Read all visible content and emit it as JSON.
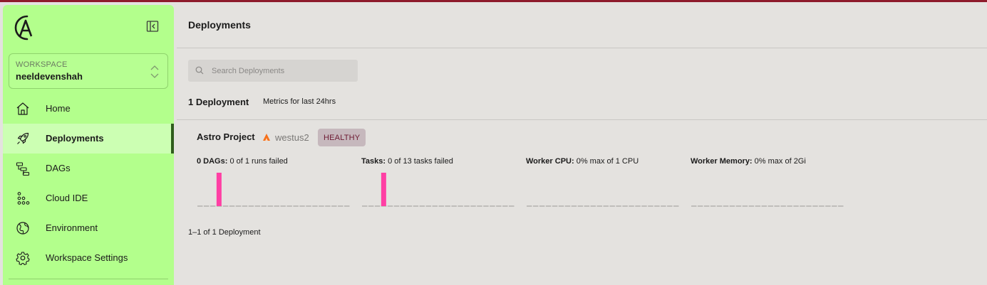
{
  "sidebar": {
    "workspace": {
      "label": "WORKSPACE",
      "name": "neeldevenshah"
    },
    "items": [
      {
        "label": "Home",
        "icon": "home-icon"
      },
      {
        "label": "Deployments",
        "icon": "rocket-icon",
        "active": true
      },
      {
        "label": "DAGs",
        "icon": "dag-icon"
      },
      {
        "label": "Cloud IDE",
        "icon": "cloud-ide-icon"
      },
      {
        "label": "Environment",
        "icon": "globe-icon"
      },
      {
        "label": "Workspace Settings",
        "icon": "gear-icon"
      }
    ]
  },
  "main": {
    "title": "Deployments",
    "search": {
      "placeholder": "Search Deployments",
      "value": ""
    },
    "count": "1 Deployment",
    "metrics_note": "Metrics for last 24hrs",
    "deployment": {
      "name": "Astro Project",
      "region": "westus2",
      "status": "HEALTHY",
      "metrics": [
        {
          "label": "0 DAGs:",
          "detail": "0 of 1 runs failed"
        },
        {
          "label": "Tasks:",
          "detail": "0 of 13 tasks failed"
        },
        {
          "label": "Worker CPU:",
          "detail": "0% max of 1 CPU"
        },
        {
          "label": "Worker Memory:",
          "detail": "0% max of 2Gi"
        }
      ]
    },
    "pagination": "1–1 of 1 Deployment"
  },
  "chart_data": [
    {
      "type": "bar",
      "series": [
        {
          "values": [
            0,
            0,
            0,
            1,
            0,
            0,
            0,
            0,
            0,
            0,
            0,
            0,
            0,
            0,
            0,
            0,
            0,
            0,
            0,
            0,
            0,
            0,
            0,
            0
          ]
        }
      ]
    },
    {
      "type": "bar",
      "series": [
        {
          "values": [
            0,
            0,
            0,
            1,
            0,
            0,
            0,
            0,
            0,
            0,
            0,
            0,
            0,
            0,
            0,
            0,
            0,
            0,
            0,
            0,
            0,
            0,
            0,
            0
          ]
        }
      ]
    },
    {
      "type": "bar",
      "series": [
        {
          "values": [
            0,
            0,
            0,
            0,
            0,
            0,
            0,
            0,
            0,
            0,
            0,
            0,
            0,
            0,
            0,
            0,
            0,
            0,
            0,
            0,
            0,
            0,
            0,
            0
          ]
        }
      ]
    },
    {
      "type": "bar",
      "series": [
        {
          "values": [
            0,
            0,
            0,
            0,
            0,
            0,
            0,
            0,
            0,
            0,
            0,
            0,
            0,
            0,
            0,
            0,
            0,
            0,
            0,
            0,
            0,
            0,
            0,
            0
          ]
        }
      ]
    }
  ],
  "colors": {
    "sidebar_bg": "#b3ff8c",
    "active_bg": "#ccffb3",
    "active_indicator": "#2f5d1c",
    "bar": "#ff3fa4",
    "badge_bg": "#c6b8bd",
    "badge_text": "#6d1b34",
    "region_icon": "#f6701a"
  }
}
